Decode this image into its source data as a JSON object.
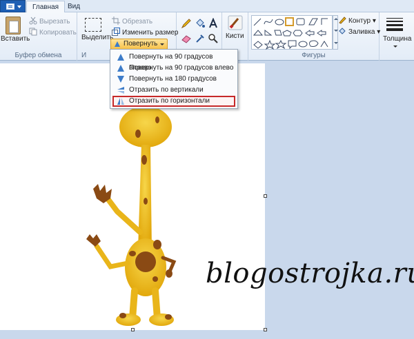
{
  "tabs": {
    "home": "Главная",
    "view": "Вид"
  },
  "clipboard": {
    "paste_label": "Вставить",
    "cut_label": "Вырезать",
    "copy_label": "Копировать",
    "group_label": "Буфер обмена"
  },
  "image": {
    "select_label": "Выделить",
    "crop_label": "Обрезать",
    "resize_label": "Изменить размер",
    "rotate_label": "Повернуть",
    "group_label": "И"
  },
  "brushes": {
    "label": "Кисти"
  },
  "shapes": {
    "outline_label": "Контур",
    "fill_label": "Заливка",
    "group_label": "Фигуры"
  },
  "thickness": {
    "label": "Толщина"
  },
  "rotate_menu": {
    "items": [
      "Повернуть на 90 градусов вправо",
      "Повернуть на 90 градусов влево",
      "Повернуть на 180 градусов",
      "Отразить по вертикали",
      "Отразить по горизонтали"
    ],
    "highlighted_index": 4
  },
  "watermark": {
    "text": "blogostrojka.ru"
  },
  "colors": {
    "highlight_border": "#c62828",
    "giraffe_body": "#f2c314",
    "giraffe_spots": "#8a4a14",
    "rotate_button": "#f7c24a"
  }
}
